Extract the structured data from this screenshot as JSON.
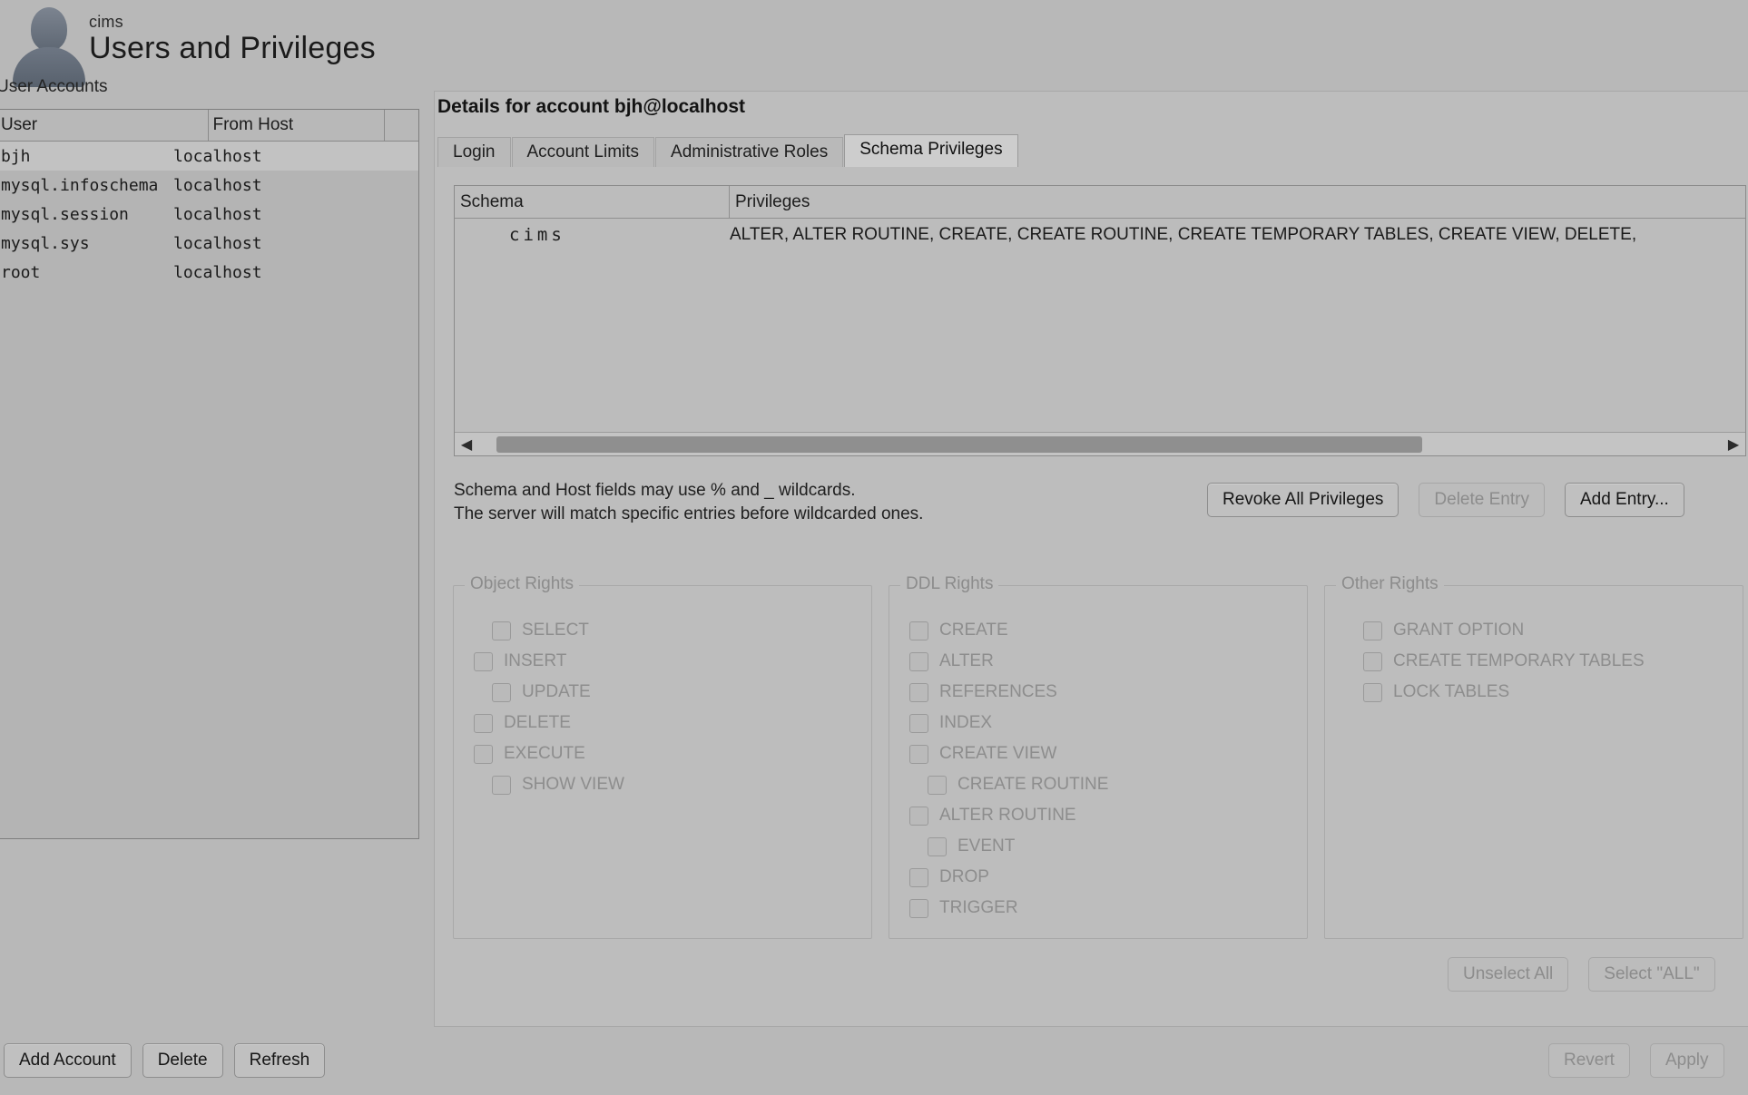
{
  "header": {
    "schema": "cims",
    "title": "Users and Privileges",
    "avatar_icon": "user-avatar-icon"
  },
  "user_accounts": {
    "label": "User Accounts",
    "columns": [
      "User",
      "From Host"
    ],
    "rows": [
      {
        "user": "bjh",
        "host": "localhost",
        "selected": true
      },
      {
        "user": "mysql.infoschema",
        "host": "localhost",
        "selected": false
      },
      {
        "user": "mysql.session",
        "host": "localhost",
        "selected": false
      },
      {
        "user": "mysql.sys",
        "host": "localhost",
        "selected": false
      },
      {
        "user": "root",
        "host": "localhost",
        "selected": false
      }
    ],
    "buttons": {
      "add_account": "Add Account",
      "delete": "Delete",
      "refresh": "Refresh"
    }
  },
  "details": {
    "title": "Details for account bjh@localhost",
    "tabs": [
      {
        "label": "Login",
        "active": false
      },
      {
        "label": "Account Limits",
        "active": false
      },
      {
        "label": "Administrative Roles",
        "active": false
      },
      {
        "label": "Schema Privileges",
        "active": true
      }
    ],
    "schema_table": {
      "columns": [
        "Schema",
        "Privileges"
      ],
      "rows": [
        {
          "schema": "cims",
          "privileges": "ALTER, ALTER ROUTINE, CREATE, CREATE ROUTINE, CREATE TEMPORARY TABLES, CREATE VIEW, DELETE,"
        }
      ],
      "scrollbar": {
        "left_arrow_icon": "chevron-left-icon",
        "right_arrow_icon": "chevron-right-icon"
      }
    },
    "help_line_1": "Schema and Host fields may use % and _ wildcards.",
    "help_line_2": "The server will match specific entries before wildcarded ones.",
    "entry_buttons": {
      "revoke_all": "Revoke All Privileges",
      "delete_entry": "Delete Entry",
      "add_entry": "Add Entry..."
    },
    "rights": {
      "object": {
        "legend": "Object Rights",
        "items": [
          {
            "label": "SELECT",
            "checked": false,
            "indent": true
          },
          {
            "label": "INSERT",
            "checked": false,
            "indent": false
          },
          {
            "label": "UPDATE",
            "checked": false,
            "indent": true
          },
          {
            "label": "DELETE",
            "checked": false,
            "indent": false
          },
          {
            "label": "EXECUTE",
            "checked": false,
            "indent": false
          },
          {
            "label": "SHOW VIEW",
            "checked": false,
            "indent": true
          }
        ]
      },
      "ddl": {
        "legend": "DDL Rights",
        "items": [
          {
            "label": "CREATE",
            "checked": false,
            "indent": false
          },
          {
            "label": "ALTER",
            "checked": false,
            "indent": false
          },
          {
            "label": "REFERENCES",
            "checked": false,
            "indent": false
          },
          {
            "label": "INDEX",
            "checked": false,
            "indent": false
          },
          {
            "label": "CREATE VIEW",
            "checked": false,
            "indent": false
          },
          {
            "label": "CREATE ROUTINE",
            "checked": false,
            "indent": true
          },
          {
            "label": "ALTER ROUTINE",
            "checked": false,
            "indent": false
          },
          {
            "label": "EVENT",
            "checked": false,
            "indent": true
          },
          {
            "label": "DROP",
            "checked": false,
            "indent": false
          },
          {
            "label": "TRIGGER",
            "checked": false,
            "indent": false
          }
        ]
      },
      "other": {
        "legend": "Other Rights",
        "items": [
          {
            "label": "GRANT OPTION",
            "checked": false,
            "indent": true
          },
          {
            "label": "CREATE TEMPORARY TABLES",
            "checked": false,
            "indent": true
          },
          {
            "label": "LOCK TABLES",
            "checked": false,
            "indent": true
          }
        ]
      }
    },
    "select_buttons": {
      "unselect_all": "Unselect All",
      "select_all": "Select \"ALL\""
    }
  },
  "footer": {
    "revert": "Revert",
    "apply": "Apply"
  },
  "colors": {
    "window_bg": "#b8b8b8",
    "panel_bg": "#bdbdbd",
    "border": "#8b8b8b",
    "disabled_text": "#8d8d8d",
    "text": "#1a1a1a",
    "selected_row": "#c2c2c2"
  }
}
